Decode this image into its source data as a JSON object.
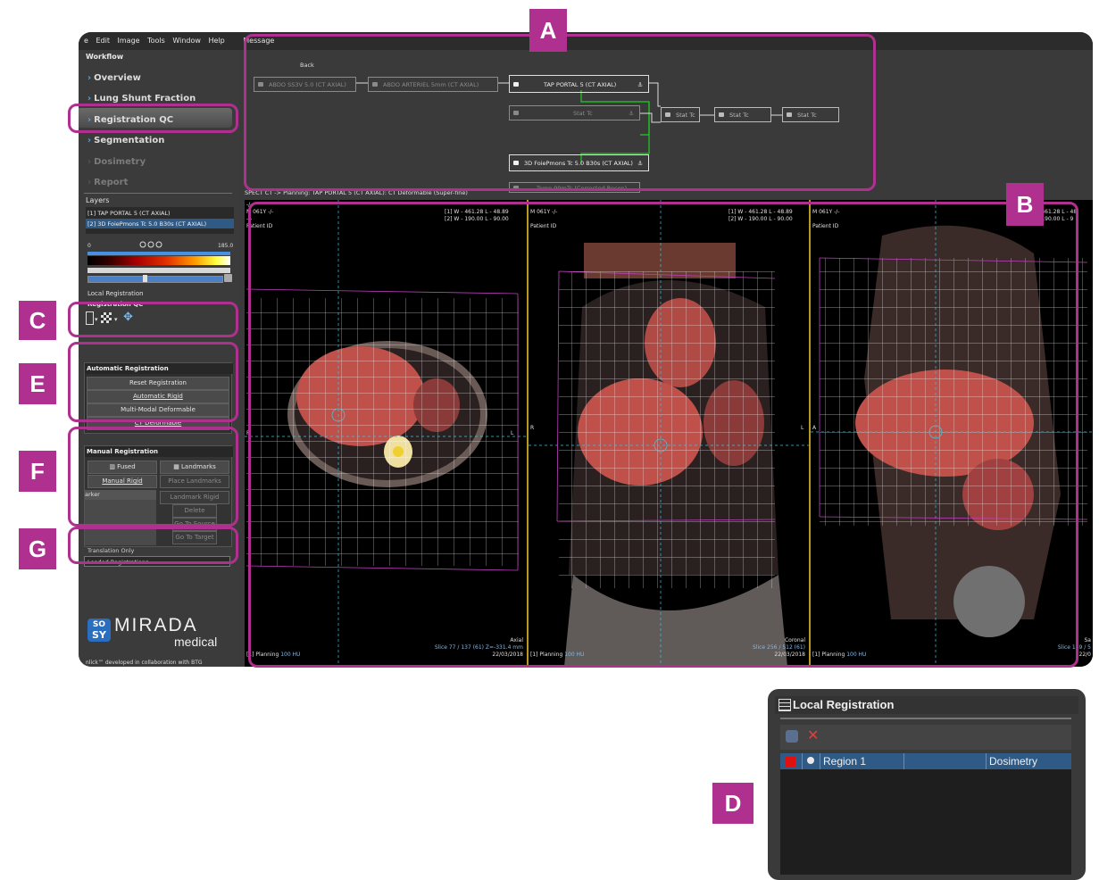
{
  "menubar": {
    "items": [
      "e",
      "Edit",
      "Image",
      "Tools",
      "Window",
      "Help",
      "Message"
    ]
  },
  "workflow": {
    "title": "Workflow",
    "items": [
      {
        "label": "Overview",
        "state": "done"
      },
      {
        "label": "Lung Shunt Fraction",
        "state": "done"
      },
      {
        "label": "Registration QC",
        "state": "active"
      },
      {
        "label": "Segmentation",
        "state": "done"
      },
      {
        "label": "Dosimetry",
        "state": "disabled"
      },
      {
        "label": "Report",
        "state": "disabled"
      }
    ]
  },
  "layers": {
    "title": "Layers",
    "items": [
      "[1] TAP  PORTAL 5 (CT AXIAL)",
      "[2] 3D FoiePmons Tc  5.0  B30s (CT AXIAL)"
    ],
    "scale_min": "0",
    "scale_max": "185.0"
  },
  "local_registration_label": "Local Registration",
  "registration_qc_label": "Registration QC",
  "automatic_registration": {
    "title": "Automatic Registration",
    "buttons": [
      "Reset Registration",
      "Automatic Rigid",
      "Multi-Modal Deformable",
      "CT Deformable"
    ]
  },
  "manual_registration": {
    "title": "Manual Registration",
    "fused": "Fused",
    "landmarks": "Landmarks",
    "manual_rigid": "Manual Rigid",
    "place_landmarks": "Place Landmarks",
    "marker_col": "arker",
    "landmark_rigid": "Landmark Rigid",
    "delete": "Delete",
    "go_to_source": "Go To Source",
    "go_to_target": "Go To Target"
  },
  "translation_only": "Translation Only",
  "loaded_registrations": "Loaded Registrations",
  "logo": {
    "brand": "MIRADA",
    "sub": "medical",
    "badge_top": "SO",
    "badge_bottom": "SY",
    "footer": "nlick™ developed in collaboration with BTG"
  },
  "flow": {
    "back": "Back",
    "nodes": [
      "ABDO SS3V  5.0 (CT AXIAL)",
      "ABDO ARTERIEL 5mm (CT AXIAL)",
      "TAP  PORTAL 5 (CT AXIAL)",
      "Stat Tc",
      "Stat Tc",
      "Stat Tc",
      "Stat Tc",
      "3D FoiePmons Tc  5.0  B30s (CT AXIAL)",
      "Tomo 99mTc (Corrected Recon)"
    ]
  },
  "status_line": "SPECT CT -> Planning: TAP  PORTAL 5 (CT AXIAL): CT Deformable (Super-fine)",
  "viewports": [
    {
      "name": "axial",
      "tl1": "-/-",
      "tl2": "M 061Y -/-",
      "tl3": "-/-",
      "tl4": "Patient ID",
      "tr1": "[1] W - 461.28  L - 48.89",
      "tr2": "[2] W - 190.00  L - 90.00",
      "ml": "R",
      "mr": "L",
      "br1": "Axial",
      "br2": "Slice 77 / 137 (61) Z=-331.4 mm",
      "br3": "22/03/2018",
      "bl": "[1] Planning",
      "blv": "100 HU"
    },
    {
      "name": "coronal",
      "tl1": "-/-",
      "tl2": "M 061Y -/-",
      "tl3": "-/-",
      "tl4": "Patient ID",
      "tr1": "[1] W - 461.28  L - 48.89",
      "tr2": "[2] W - 190.00  L - 90.00",
      "ml": "R",
      "mr": "L",
      "br1": "Coronal",
      "br2": "Slice 256 / 512 (61)",
      "br3": "22/03/2018",
      "bl": "[1] Planning",
      "blv": "100 HU"
    },
    {
      "name": "sagittal",
      "tl1": "-/-",
      "tl2": "M 061Y -/-",
      "tl3": "-/-",
      "tl4": "Patient ID",
      "tr1": "[1] W - 461.28  L - 48",
      "tr2": "[2] W - 190.00  L - 9",
      "ml": "A",
      "mr": "",
      "br1": "Sa",
      "br2": "Slice 149 / 5",
      "br3": "22/0",
      "bl": "[1] Planning",
      "blv": "100 HU"
    }
  ],
  "local_registration": {
    "title": "Local Registration",
    "row": {
      "name": "Region 1",
      "type": "Dosimetry"
    }
  },
  "callouts": [
    "A",
    "B",
    "C",
    "D",
    "E",
    "F",
    "G"
  ],
  "colors": {
    "accent": "#b0308f",
    "selection": "#2f5a86",
    "region": "#e01010",
    "flow_link": "#22cc22"
  }
}
